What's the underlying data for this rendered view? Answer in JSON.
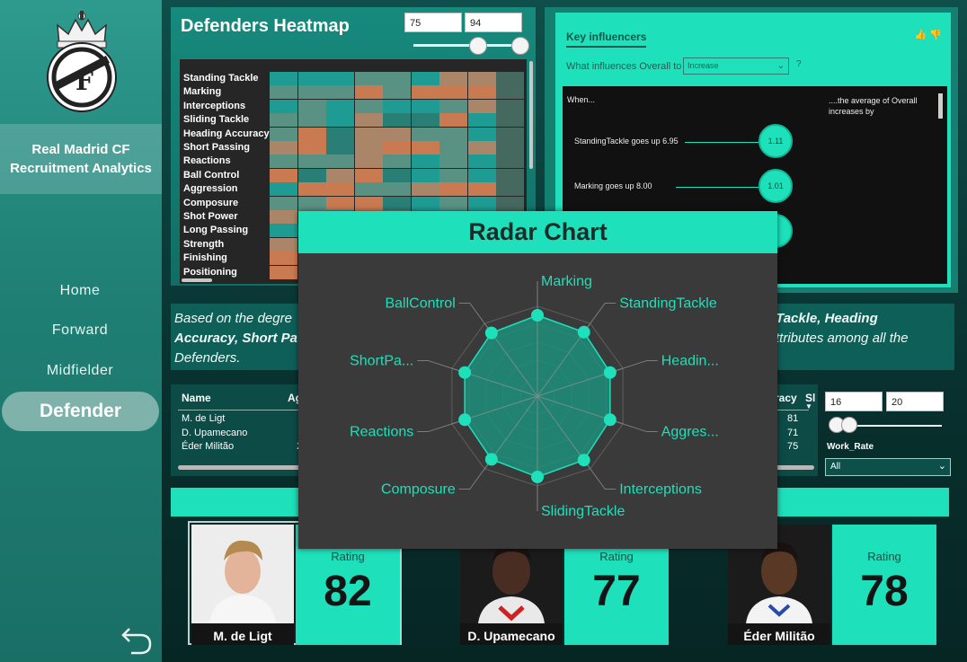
{
  "sidebar": {
    "club_line1": "Real Madrid CF",
    "club_line2": "Recruitment Analytics",
    "nav": [
      "Home",
      "Forward",
      "Midfielder",
      "Defender"
    ],
    "active": "Defender"
  },
  "heatmap": {
    "title": "Defenders Heatmap",
    "range_min": "75",
    "range_max": "94",
    "rows": [
      "Standing Tackle",
      "Marking",
      "Interceptions",
      "Sliding Tackle",
      "Heading Accuracy",
      "Short Passing",
      "Reactions",
      "Ball Control",
      "Aggression",
      "Composure",
      "Shot Power",
      "Long Passing",
      "Strength",
      "Finishing",
      "Positioning"
    ],
    "colors": {
      "teal": "#1eaaa0",
      "mid": "#5f9f8e",
      "orange": "#dd8456",
      "light": "#b99070",
      "dark": "#2a8a80"
    }
  },
  "key_influencers": {
    "tab": "Key influencers",
    "question": "What influences Overall to",
    "dropdown_value": "Increase",
    "qmark": "?",
    "when": "When...",
    "avg_label": "....the average of Overall increases by",
    "items": [
      {
        "label": "StandingTackle goes up 6.95",
        "value": "1.11"
      },
      {
        "label": "Marking goes up 8.00",
        "value": "1.01"
      }
    ]
  },
  "insight": {
    "line_start": "Based on the degre",
    "bold_right": "Sliding Tackle, Heading",
    "bold_left": "Accuracy, Short Pa",
    "line2_end": "y attributes among all the",
    "line3": "Defenders."
  },
  "table": {
    "headers": [
      "Name",
      "Ag",
      "racy",
      "Sl"
    ],
    "rows": [
      {
        "name": "M. de Ligt",
        "col2": "",
        "val": "81"
      },
      {
        "name": "D. Upamecano",
        "col2": "",
        "val": "71"
      },
      {
        "name": "Éder Militão",
        "col2": "2",
        "val": "75"
      }
    ]
  },
  "work_rate": {
    "range_min": "16",
    "range_max": "20",
    "label": "Work_Rate",
    "select_value": "All"
  },
  "radar": {
    "title": "Radar Chart",
    "axes": [
      "Marking",
      "StandingTackle",
      "Headin...",
      "Aggres...",
      "Interceptions",
      "SlidingTackle",
      "Composure",
      "Reactions",
      "ShortPa...",
      "BallControl"
    ]
  },
  "players": [
    {
      "name": "M. de Ligt",
      "rating_label": "Rating",
      "rating": "82"
    },
    {
      "name": "D. Upamecano",
      "rating_label": "Rating",
      "rating": "77"
    },
    {
      "name": "Éder Militão",
      "rating_label": "Rating",
      "rating": "78"
    }
  ],
  "accent_color": "#1ee0ba"
}
